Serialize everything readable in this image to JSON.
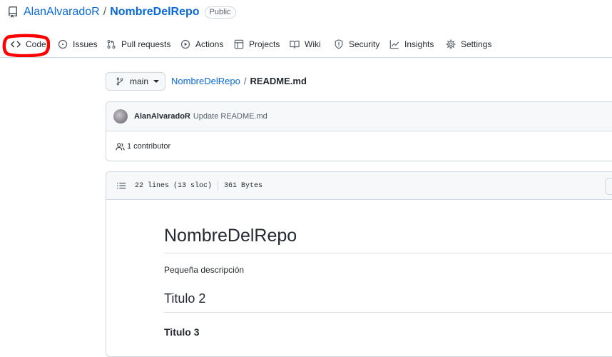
{
  "repo": {
    "owner": "AlanAlvaradoR",
    "separator": "/",
    "name": "NombreDelRepo",
    "visibility": "Public"
  },
  "nav": {
    "tabs": [
      {
        "label": "Code",
        "icon": "code-icon"
      },
      {
        "label": "Issues",
        "icon": "issue-circle-icon"
      },
      {
        "label": "Pull requests",
        "icon": "pull-request-icon"
      },
      {
        "label": "Actions",
        "icon": "play-icon"
      },
      {
        "label": "Projects",
        "icon": "table-icon"
      },
      {
        "label": "Wiki",
        "icon": "book-icon"
      },
      {
        "label": "Security",
        "icon": "shield-icon"
      },
      {
        "label": "Insights",
        "icon": "graph-icon"
      },
      {
        "label": "Settings",
        "icon": "gear-icon"
      }
    ],
    "annotation_color": "#ff0000"
  },
  "branch": {
    "name": "main"
  },
  "path": {
    "repo": "NombreDelRepo",
    "separator": "/",
    "file": "README.md"
  },
  "commit": {
    "author": "AlanAlvaradoR",
    "message": "Update README.md"
  },
  "contributors": {
    "text": "1 contributor"
  },
  "file": {
    "lines": "22 lines (13 sloc)",
    "size": "361 Bytes"
  },
  "readme": {
    "h1": "NombreDelRepo",
    "description": "Pequeña descripción",
    "h2": "Titulo 2",
    "h3": "Titulo 3"
  },
  "colors": {
    "link": "#0969da",
    "border": "#d0d7de",
    "subtle_bg": "#f6f8fa"
  }
}
